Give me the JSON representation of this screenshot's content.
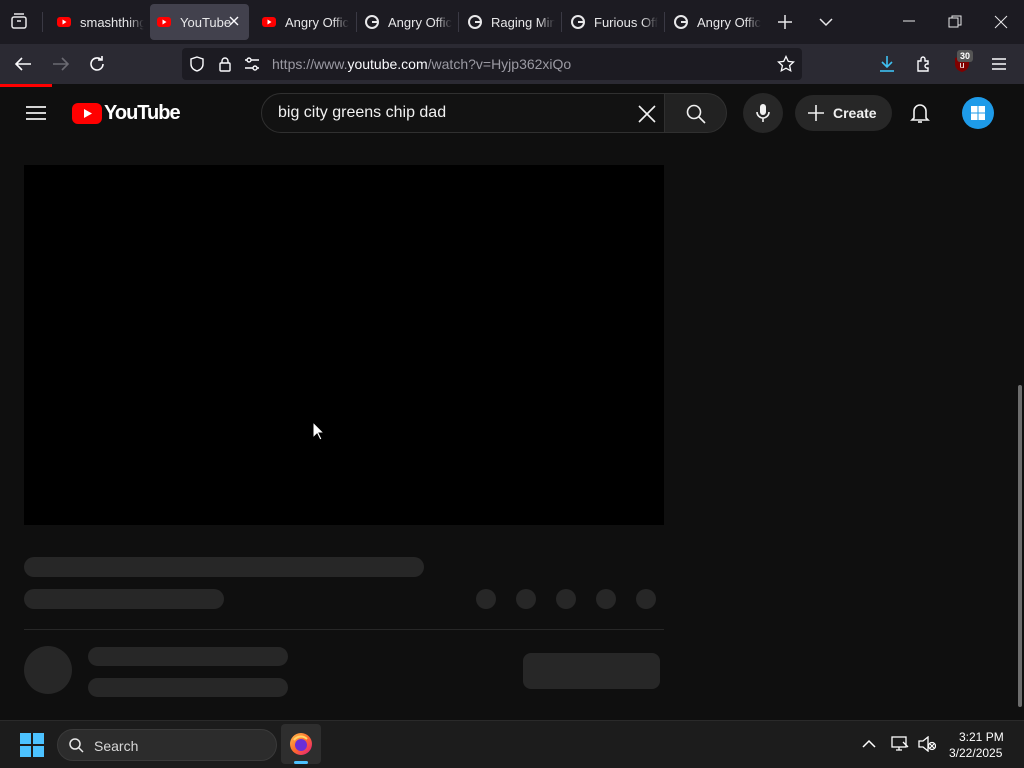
{
  "browser": {
    "tabs": [
      {
        "label": "smashthing",
        "favicon": "youtube-favicon"
      },
      {
        "label": "YouTube",
        "favicon": "youtube-favicon",
        "active": true
      },
      {
        "label": "Angry Offic",
        "favicon": "youtube-favicon"
      },
      {
        "label": "Angry Offic",
        "favicon": "google-favicon"
      },
      {
        "label": "Raging Min",
        "favicon": "google-favicon"
      },
      {
        "label": "Furious Off",
        "favicon": "google-favicon"
      },
      {
        "label": "Angry Offic",
        "favicon": "google-favicon"
      }
    ],
    "url_prefix": "https://www.",
    "url_domain": "youtube.com",
    "url_path": "/watch?v=Hyjp362xiQo",
    "extension_badge": "30",
    "accent_color": "#ff0000"
  },
  "youtube": {
    "logo_text": "YouTube",
    "search_value": "big city greens chip dad",
    "create_label": "Create"
  },
  "taskbar": {
    "search_label": "Search",
    "time": "3:21 PM",
    "date": "3/22/2025"
  }
}
